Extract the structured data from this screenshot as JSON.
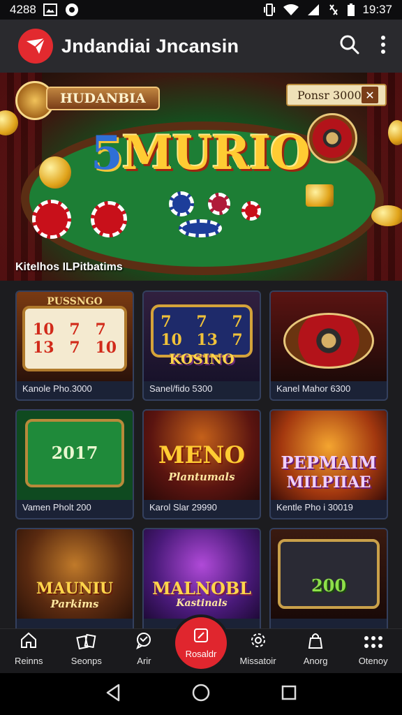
{
  "status_bar": {
    "left_text": "4288",
    "time": "19:37"
  },
  "app": {
    "title": "Jndandiai Jncansin",
    "brand_color": "#e22a2f"
  },
  "hero": {
    "ribbon": "HUDANBIA",
    "title_number": "5",
    "title_word": "MURIO",
    "price_text": "Ponsr 3000",
    "caption": "Kitelhos ILPitbatims"
  },
  "games": [
    {
      "art_text": "PUSSNGO",
      "label": "Kanole Pho.3000"
    },
    {
      "art_text": "KOSINO",
      "label": "Sanel/fido 5300"
    },
    {
      "art_text": "",
      "label": "Kanel Mahor 6300"
    },
    {
      "art_text": "2017",
      "label": "Vamen Pholt 200"
    },
    {
      "art_text": "MENO",
      "art_sub": "Plantumals",
      "label": "Karol Slar 29990"
    },
    {
      "art_text": "PEPMAIM",
      "art_sub": "MILPIIAE",
      "label": "Kentle Pho i 30019"
    },
    {
      "art_text": "MAUNIU",
      "art_sub": "Parkims",
      "label": ""
    },
    {
      "art_text": "MALNOBL",
      "art_sub": "Kastinals",
      "label": ""
    },
    {
      "art_text": "200",
      "label": ""
    }
  ],
  "bottom_nav": [
    {
      "label": "Reinns",
      "icon": "home-icon"
    },
    {
      "label": "Seonps",
      "icon": "cards-icon"
    },
    {
      "label": "Arir",
      "icon": "chat-icon"
    },
    {
      "label": "Rosaldr",
      "icon": "square-icon"
    },
    {
      "label": "Missatoir",
      "icon": "gear-icon"
    },
    {
      "label": "Anorg",
      "icon": "bag-icon"
    },
    {
      "label": "Otenoy",
      "icon": "grid-dots-icon"
    }
  ]
}
